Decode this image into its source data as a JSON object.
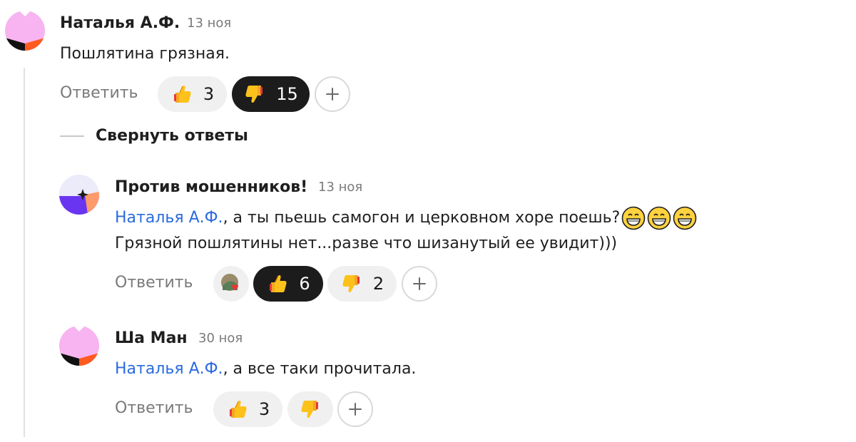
{
  "thread": {
    "collapse_label": "Свернуть ответы"
  },
  "comments": [
    {
      "author": "Наталья А.Ф.",
      "date": "13 ноя",
      "text": "Пошлятина грязная.",
      "reply_label": "Ответить",
      "reactions": [
        {
          "icon": "thumbs-up-icon",
          "count": "3",
          "active": false
        },
        {
          "icon": "thumbs-down-icon",
          "count": "15",
          "active": true
        }
      ]
    },
    {
      "author": "Против мошенников!",
      "date": "13 ноя",
      "mention": "Наталья А.Ф.",
      "text_line1": ", а ты пьешь самогон и церковном хоре поешь?",
      "text_line2": "Грязной пошлятины нет...разве что шизанутый ее увидит)))",
      "emoji_count": 3,
      "reply_label": "Ответить",
      "reactions": [
        {
          "icon": "avatar-heart-icon",
          "count": "",
          "active": false
        },
        {
          "icon": "thumbs-up-icon",
          "count": "6",
          "active": true
        },
        {
          "icon": "thumbs-down-icon",
          "count": "2",
          "active": false
        }
      ]
    },
    {
      "author": "Ша Ман",
      "date": "30 ноя",
      "mention": "Наталья А.Ф.",
      "text": ", а все таки прочитала.",
      "reply_label": "Ответить",
      "reactions": [
        {
          "icon": "thumbs-up-icon",
          "count": "3",
          "active": false
        },
        {
          "icon": "thumbs-down-icon",
          "count": "",
          "active": false
        }
      ]
    }
  ],
  "colors": {
    "mention": "#2a6be0",
    "muted": "#7a7a7a",
    "pill_bg": "#f0f0f0",
    "pill_active_bg": "#1c1c1c"
  }
}
